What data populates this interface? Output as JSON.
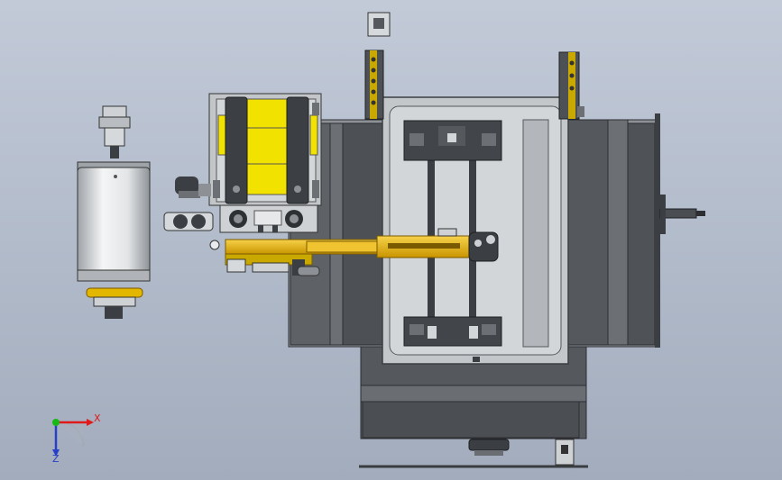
{
  "scene": {
    "description_free": true,
    "background_colors": [
      "#c2cad8",
      "#a2acbc"
    ],
    "colors": {
      "frame_gray": "#5d6166",
      "panel_light": "#c9cccf",
      "accent_yellow": "#f2d300",
      "arm_gold": "#e8b40c",
      "dark_steel": "#3b3e42"
    }
  },
  "triad": {
    "x_label": "X",
    "z_label": "Z",
    "x_color": "#e01a1a",
    "z_color": "#2840c8",
    "y_color": "#18b818"
  }
}
